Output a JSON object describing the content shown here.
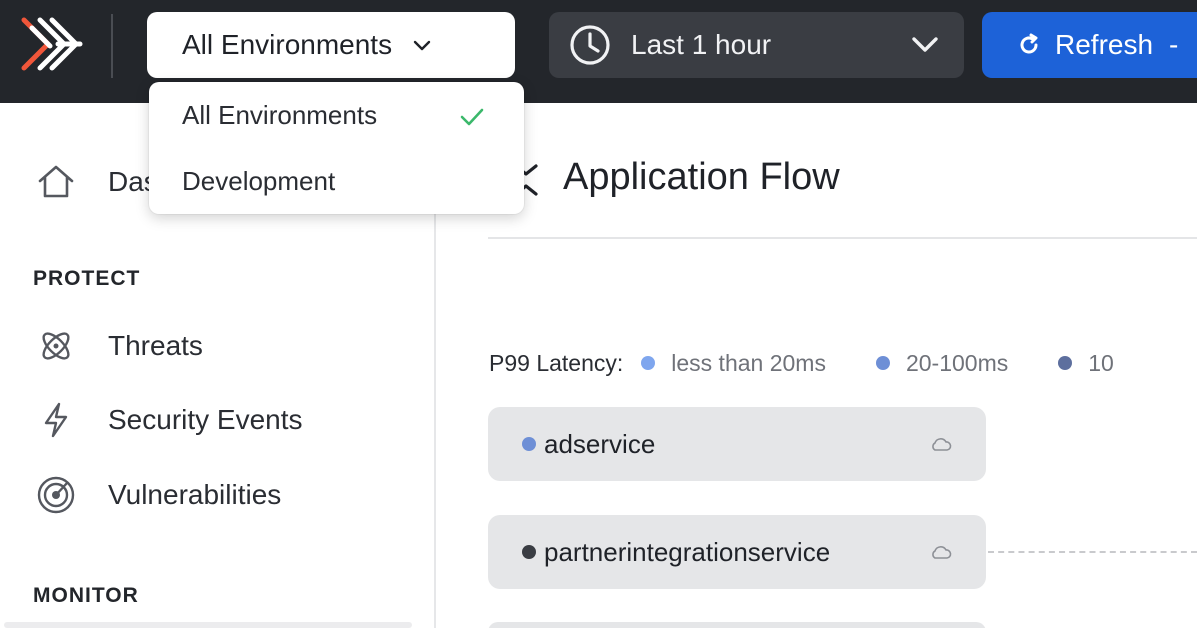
{
  "topbar": {
    "environment_label": "All Environments",
    "time_range_label": "Last 1 hour",
    "refresh_label": "Refresh",
    "refresh_suffix": "-"
  },
  "environment_menu": {
    "items": [
      {
        "label": "All Environments",
        "selected": true
      },
      {
        "label": "Development",
        "selected": false
      }
    ]
  },
  "sidebar": {
    "dashboard_label": "Das",
    "sections": [
      {
        "title": "PROTECT",
        "items": [
          {
            "label": "Threats",
            "icon": "atom-icon"
          },
          {
            "label": "Security Events",
            "icon": "bolt-icon"
          },
          {
            "label": "Vulnerabilities",
            "icon": "radar-icon"
          }
        ]
      },
      {
        "title": "MONITOR",
        "items": []
      }
    ]
  },
  "main": {
    "title": "Application Flow",
    "legend": {
      "label": "P99 Latency:",
      "entries": [
        {
          "label": "less than 20ms",
          "color": "#7fa6ee"
        },
        {
          "label": "20-100ms",
          "color": "#6e8fd6"
        },
        {
          "label": "10",
          "color": "#5d6f9e"
        }
      ]
    },
    "services": [
      {
        "name": "adservice",
        "dot_color": "#6e8fd6"
      },
      {
        "name": "partnerintegrationservice",
        "dot_color": "#3a3d43"
      }
    ]
  },
  "colors": {
    "topbar_bg": "#23262b",
    "accent_blue": "#1d62d8",
    "check_green": "#3bb86b"
  }
}
